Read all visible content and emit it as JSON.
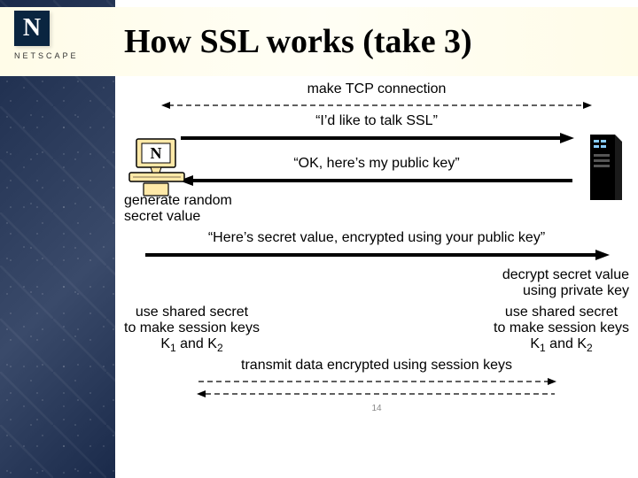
{
  "logo": {
    "letter": "N",
    "brand": "NETSCAPE"
  },
  "title": "How SSL works (take 3)",
  "steps": {
    "tcp": "make TCP connection",
    "hello": "“I’d like to talk SSL”",
    "ok": "“OK, here’s my public key”",
    "gen": "generate random\nsecret value",
    "send_secret": "“Here’s secret value, encrypted using your public key”",
    "decrypt": "decrypt secret value\nusing private key",
    "session_left": "use shared secret\nto make session keys",
    "session_right": "use shared secret\nto make session keys",
    "k1": "K",
    "k1sub": "1",
    "and": " and ",
    "k2": "K",
    "k2sub": "2",
    "transmit": "transmit data encrypted using session keys"
  },
  "page": "14",
  "chart_data": {
    "type": "sequence",
    "actors": [
      "Client",
      "Server"
    ],
    "messages": [
      {
        "from": "Client",
        "to": "Server",
        "label": "make TCP connection",
        "style": "dashed-both"
      },
      {
        "from": "Client",
        "to": "Server",
        "label": "“I’d like to talk SSL”",
        "style": "solid"
      },
      {
        "from": "Server",
        "to": "Client",
        "label": "“OK, here’s my public key”",
        "style": "solid"
      },
      {
        "actor": "Client",
        "note": "generate random secret value"
      },
      {
        "from": "Client",
        "to": "Server",
        "label": "“Here’s secret value, encrypted using your public key”",
        "style": "solid"
      },
      {
        "actor": "Server",
        "note": "decrypt secret value using private key"
      },
      {
        "actor": "Client",
        "note": "use shared secret to make session keys K1 and K2"
      },
      {
        "actor": "Server",
        "note": "use shared secret to make session keys K1 and K2"
      },
      {
        "from": "Client",
        "to": "Server",
        "label": "transmit data encrypted using session keys",
        "style": "dashed-both"
      }
    ]
  }
}
